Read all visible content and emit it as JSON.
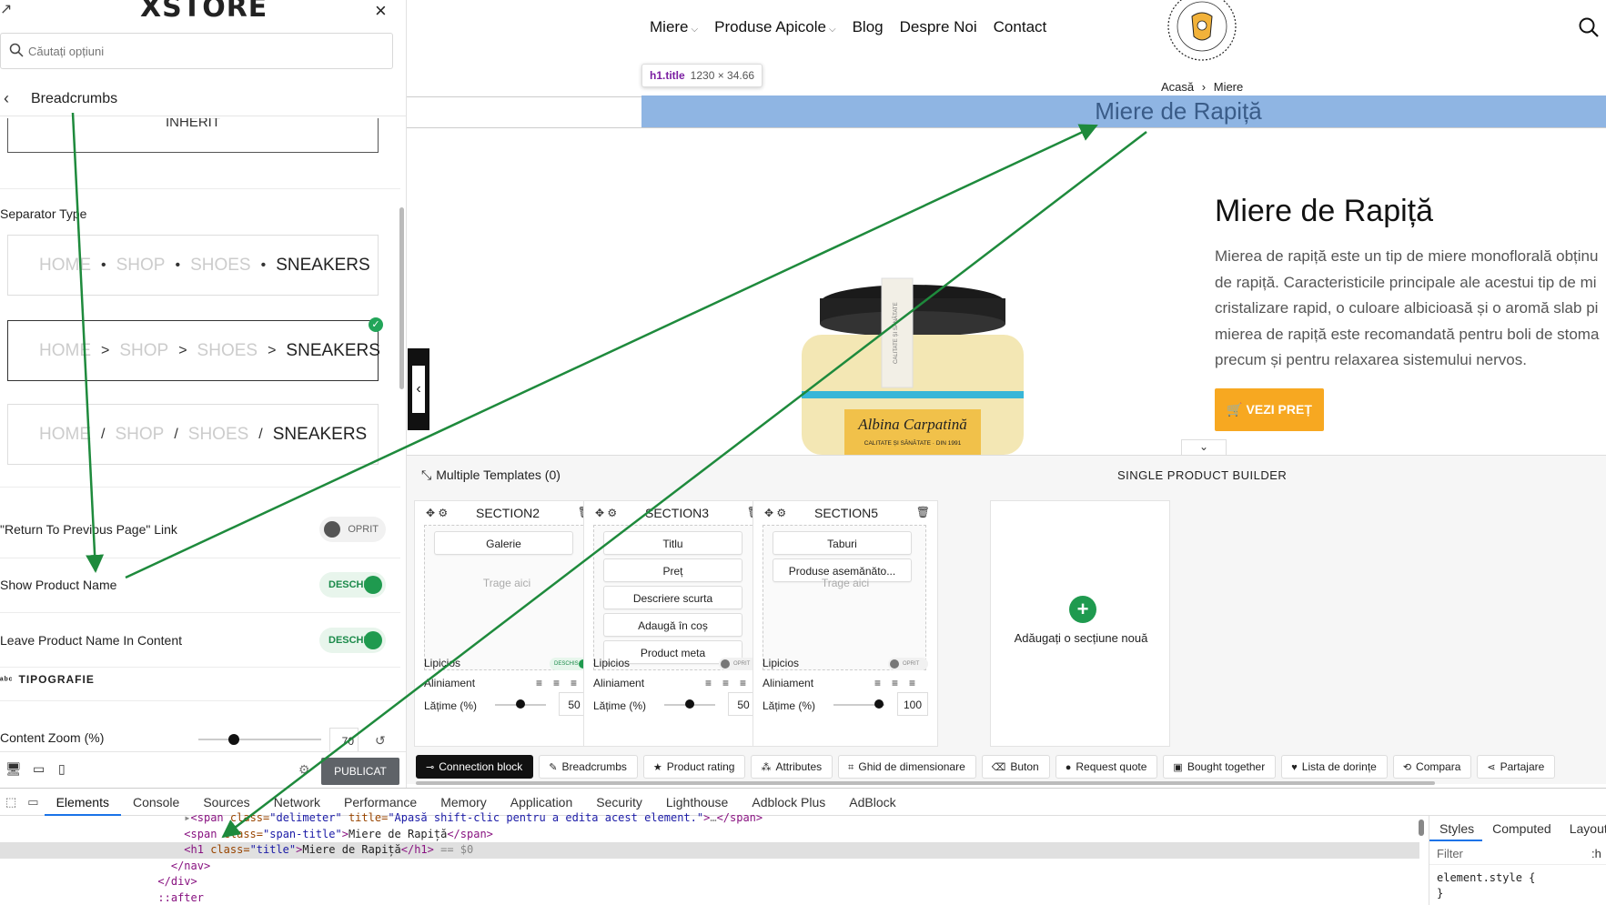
{
  "panel": {
    "logo": "XSTORE",
    "search_placeholder": "Căutați opțiuni",
    "section_title": "Breadcrumbs",
    "inherit_text": "INHERIT",
    "separator_type_label": "Separator Type",
    "separator_options": [
      {
        "crumbs": [
          "HOME",
          "SHOP",
          "SHOES",
          "SNEAKERS"
        ],
        "sep": "•",
        "selected": false
      },
      {
        "crumbs": [
          "HOME",
          "SHOP",
          "SHOES",
          "SNEAKERS"
        ],
        "sep": ">",
        "selected": true
      },
      {
        "crumbs": [
          "HOME",
          "SHOP",
          "SHOES",
          "SNEAKERS"
        ],
        "sep": "/",
        "selected": false
      }
    ],
    "toggles": [
      {
        "label": "\"Return To Previous Page\" Link",
        "state": "OPRIT",
        "on": false
      },
      {
        "label": "Show Product Name",
        "state": "DESCHIS",
        "on": true
      },
      {
        "label": "Leave Product Name In Content",
        "state": "DESCHIS",
        "on": true
      }
    ],
    "typography_label": "TIPOGRAFIE",
    "content_zoom_label": "Content Zoom (%)",
    "content_zoom_value": "70",
    "publish_label": "PUBLICAT"
  },
  "site": {
    "nav": [
      {
        "label": "Miere",
        "dropdown": true
      },
      {
        "label": "Produse Apicole",
        "dropdown": true
      },
      {
        "label": "Blog",
        "dropdown": false
      },
      {
        "label": "Despre Noi",
        "dropdown": false
      },
      {
        "label": "Contact",
        "dropdown": false
      }
    ],
    "breadcrumb": {
      "home": "Acasă",
      "sep": "›",
      "current": "Miere"
    },
    "inspect_tooltip": {
      "selector": "h1.title",
      "size": "1230 × 34.66"
    },
    "h1_title": "Miere de Rapiță",
    "product_title": "Miere de Rapiță",
    "product_desc_lines": [
      "Mierea de rapiță este un tip de miere monoflorală obținu",
      "de rapiță. Caracteristicile principale ale acestui tip de mi",
      "cristalizare rapid, o culoare albicioasă și o aromă slab pi",
      "mierea de rapiță este recomandată pentru boli de stoma",
      "precum și pentru relaxarea sistemului nervos."
    ],
    "buy_button": "VEZI PREȚ",
    "jar_label_brand": "Albina Carpatină",
    "jar_label_sub": "CALITATE ȘI SĂNĂTATE · DIN 1991",
    "jar_strip_text": "CALITATE ȘI SĂNĂTATE"
  },
  "builder": {
    "templates_label": "Multiple Templates (0)",
    "title": "SINGLE PRODUCT BUILDER",
    "sections": [
      {
        "name": "SECTION2",
        "chips": [
          "Galerie"
        ],
        "drop_text": "Trage aici",
        "lipicios": "Lipicios",
        "lipicios_state": "DESCHIS",
        "lipicios_on": true,
        "aliniament": "Aliniament",
        "latime_label": "Lățime (%)",
        "latime": "50"
      },
      {
        "name": "SECTION3",
        "chips": [
          "Titlu",
          "Preț",
          "Descriere scurta",
          "Adaugă în coș",
          "Product meta"
        ],
        "drop_text": "",
        "lipicios": "Lipicios",
        "lipicios_state": "OPRIT",
        "lipicios_on": false,
        "aliniament": "Aliniament",
        "latime_label": "Lățime (%)",
        "latime": "50"
      },
      {
        "name": "SECTION5",
        "chips": [
          "Taburi",
          "Produse asemănăto..."
        ],
        "drop_text": "Trage aici",
        "lipicios": "Lipicios",
        "lipicios_state": "OPRIT",
        "lipicios_on": false,
        "aliniament": "Aliniament",
        "latime_label": "Lățime (%)",
        "latime": "100"
      }
    ],
    "add_section_label": "Adăugați o secțiune nouă",
    "blocks": [
      {
        "label": "Connection block",
        "icon": "link-icon",
        "active": true
      },
      {
        "label": "Breadcrumbs",
        "icon": "pen-icon",
        "active": false
      },
      {
        "label": "Product rating",
        "icon": "star-icon",
        "active": false
      },
      {
        "label": "Attributes",
        "icon": "nodes-icon",
        "active": false
      },
      {
        "label": "Ghid de dimensionare",
        "icon": "crop-icon",
        "active": false
      },
      {
        "label": "Buton",
        "icon": "eraser-icon",
        "active": false
      },
      {
        "label": "Request quote",
        "icon": "circle-icon",
        "active": false
      },
      {
        "label": "Bought together",
        "icon": "bag-icon",
        "active": false
      },
      {
        "label": "Lista de dorințe",
        "icon": "heart-icon",
        "active": false
      },
      {
        "label": "Compara",
        "icon": "refresh-icon",
        "active": false
      },
      {
        "label": "Partajare",
        "icon": "share-icon",
        "active": false
      }
    ]
  },
  "devtools": {
    "tabs": [
      "Elements",
      "Console",
      "Sources",
      "Network",
      "Performance",
      "Memory",
      "Application",
      "Security",
      "Lighthouse",
      "Adblock Plus",
      "AdBlock"
    ],
    "selected_tab": "Elements",
    "code_lines": [
      {
        "indent": "          ",
        "parts": [
          [
            "gray",
            "▸"
          ],
          [
            "tag",
            "<span "
          ],
          [
            "attr",
            "class="
          ],
          [
            "aval",
            "\"delimeter\""
          ],
          [
            "attr",
            " title="
          ],
          [
            "aval",
            "\"Apasă shift-clic pentru a edita acest element.\""
          ],
          [
            "tag",
            ">"
          ],
          [
            "gray",
            "…"
          ],
          [
            "tag",
            "</span>"
          ]
        ],
        "selected": false
      },
      {
        "indent": "          ",
        "parts": [
          [
            "tag",
            "<span "
          ],
          [
            "attr",
            "class="
          ],
          [
            "aval",
            "\"span-title\""
          ],
          [
            "tag",
            ">"
          ],
          [
            "txt",
            "Miere de Rapiță"
          ],
          [
            "tag",
            "</span>"
          ]
        ],
        "selected": false
      },
      {
        "indent": "          ",
        "parts": [
          [
            "tag",
            "<h1 "
          ],
          [
            "attr",
            "class="
          ],
          [
            "aval",
            "\"title\""
          ],
          [
            "tag",
            ">"
          ],
          [
            "txt",
            "Miere de Rapiță"
          ],
          [
            "tag",
            "</h1>"
          ],
          [
            "gray",
            " == $0"
          ]
        ],
        "selected": true
      },
      {
        "indent": "        ",
        "parts": [
          [
            "tag",
            "</nav>"
          ]
        ],
        "selected": false
      },
      {
        "indent": "      ",
        "parts": [
          [
            "tag",
            "</div>"
          ]
        ],
        "selected": false
      },
      {
        "indent": "      ",
        "parts": [
          [
            "tag",
            "::after"
          ]
        ],
        "selected": false
      }
    ],
    "styles_tabs": [
      "Styles",
      "Computed",
      "Layout"
    ],
    "filter_placeholder": "Filter",
    "filter_suffix": ":h",
    "style_rule": "element.style {",
    "style_rule_end": "}"
  }
}
